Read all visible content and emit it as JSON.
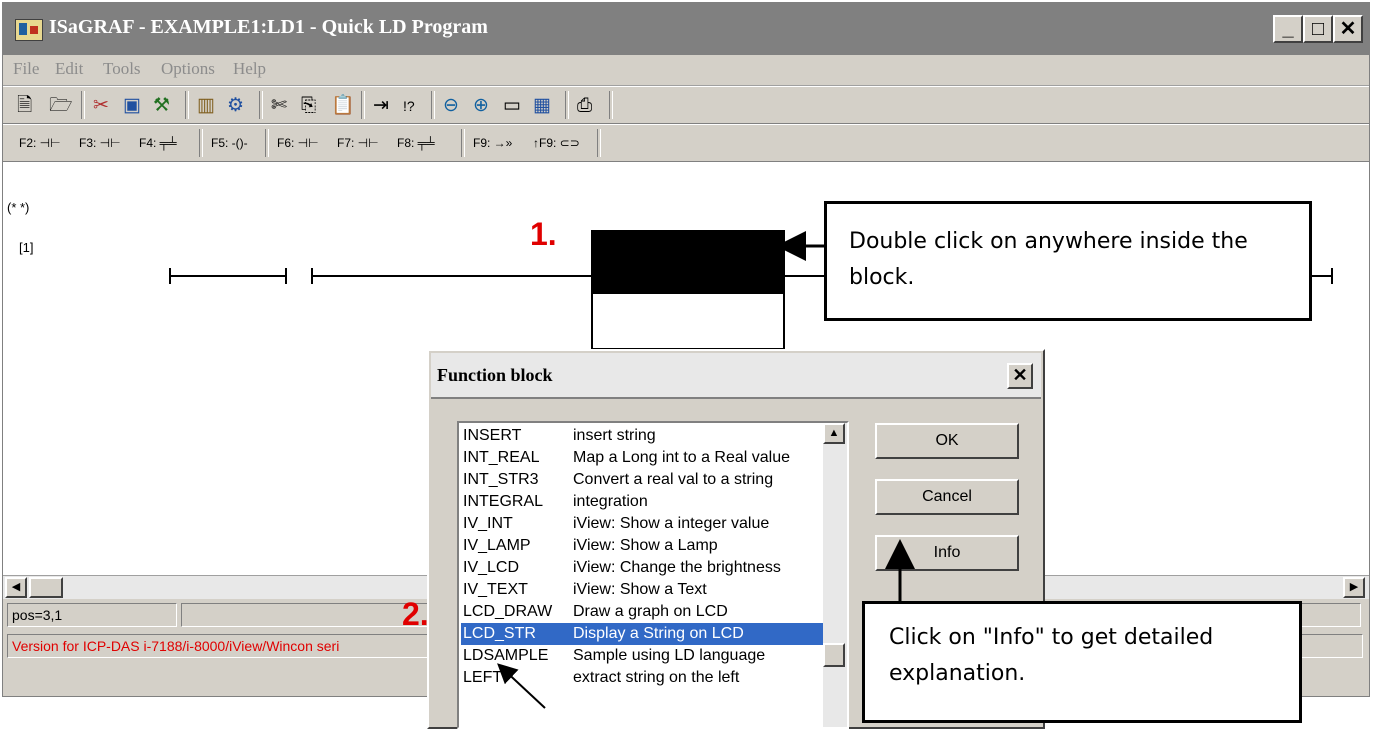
{
  "window": {
    "title": "ISaGRAF - EXAMPLE1:LD1 - Quick LD Program",
    "minimize": "_",
    "maximize": "□",
    "close": "✕"
  },
  "menu": [
    "File",
    "Edit",
    "Tools",
    "Options",
    "Help"
  ],
  "toolbar_icons": [
    "new-file-icon",
    "open-icon",
    "cut-contact-icon",
    "monitor-icon",
    "tool-icon",
    "library-icon",
    "compile-icon",
    "scissors-icon",
    "copy-icon",
    "paste-icon",
    "insert-icon",
    "variables-icon",
    "zoom-out-icon",
    "zoom-in-icon",
    "fit-icon",
    "grid-icon",
    "print-icon"
  ],
  "function_keys": [
    {
      "label": "F2: ⊣⊢",
      "name": "f2-contact"
    },
    {
      "label": "F3: ⊣⊢",
      "name": "f3-contact"
    },
    {
      "label": "F4: ╤╧",
      "name": "f4-parallel"
    },
    {
      "label": "F5: -()-",
      "name": "f5-coil"
    },
    {
      "label": "F6: ⊣⊢",
      "name": "f6-contact-before"
    },
    {
      "label": "F7: ⊣⊢",
      "name": "f7-contact-after"
    },
    {
      "label": "F8: ╤╧",
      "name": "f8-parallel"
    },
    {
      "label": "F9: →»",
      "name": "f9-jump"
    },
    {
      "label": "↑F9: ⊂⊃",
      "name": "shift-f9-return"
    }
  ],
  "canvas": {
    "comment": "(* *)",
    "rung_label": "[1]"
  },
  "status": {
    "position": "pos=3,1",
    "message": "Version for ICP-DAS i-7188/i-8000/iView/Wincon seri"
  },
  "dialog": {
    "title": "Function block",
    "close": "✕",
    "items": [
      {
        "name": "INSERT",
        "desc": "insert string"
      },
      {
        "name": "INT_REAL",
        "desc": "Map a Long int to a Real value"
      },
      {
        "name": "INT_STR3",
        "desc": "Convert a real val to a string"
      },
      {
        "name": "INTEGRAL",
        "desc": "integration"
      },
      {
        "name": "IV_INT",
        "desc": "iView: Show a integer value"
      },
      {
        "name": "IV_LAMP",
        "desc": "iView: Show a Lamp"
      },
      {
        "name": "IV_LCD",
        "desc": "iView: Change the brightness"
      },
      {
        "name": "IV_TEXT",
        "desc": "iView: Show a Text"
      },
      {
        "name": "LCD_DRAW",
        "desc": "Draw a graph on LCD"
      },
      {
        "name": "LCD_STR",
        "desc": "Display a String on LCD"
      },
      {
        "name": "LDSAMPLE",
        "desc": "Sample using LD language"
      },
      {
        "name": "LEFT",
        "desc": "extract string on the left"
      }
    ],
    "selected_index": 9,
    "buttons": {
      "ok": "OK",
      "cancel": "Cancel",
      "info": "Info"
    }
  },
  "annotations": {
    "step1": "1.",
    "step2": "2.",
    "callout1": "Double click on anywhere inside the block.",
    "callout2": "Click on \"Info\" to get detailed explanation."
  }
}
